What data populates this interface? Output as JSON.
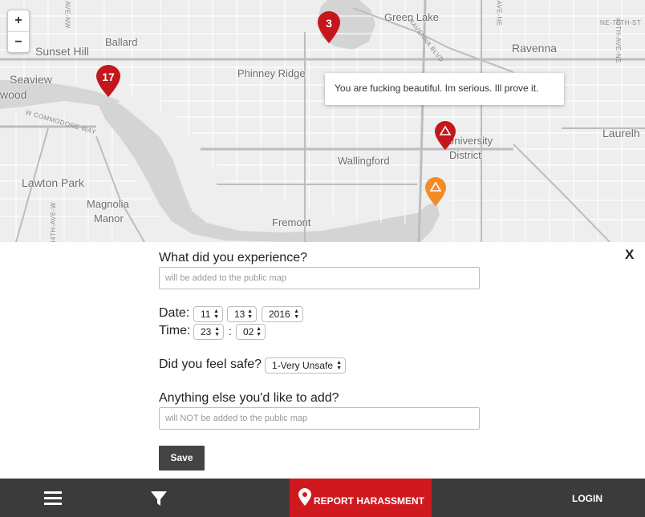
{
  "map": {
    "zoom_in_label": "+",
    "zoom_out_label": "−",
    "places": {
      "sunset_hill": "Sunset Hill",
      "ballard": "Ballard",
      "seaview": "Seaview",
      "wood": "wood",
      "phinney_ridge": "Phinney Ridge",
      "green_lake": "Green Lake",
      "ravenna": "Ravenna",
      "laurelhurst": "Laurelh",
      "university_district_1": "University",
      "university_district_2": "District",
      "wallingford": "Wallingford",
      "lawton_park": "Lawton Park",
      "magnolia_1": "Magnolia",
      "magnolia_2": "Manor",
      "fremont": "Fremont"
    },
    "streets": {
      "commodore_way": "W COMMODORE WAY",
      "ave_nw_top": "AVE-NW",
      "ave_ne": "AVE-NE",
      "ne_70th": "NE-70TH-ST",
      "ave_ne_40th": "40TH-AVE-NE",
      "ave_w_34th": "34TH-AVE-W",
      "ravenna_blvd": "RAVENNA BLVD"
    },
    "markers": [
      {
        "label": "3",
        "color": "#c4161c"
      },
      {
        "label": "17",
        "color": "#c4161c"
      },
      {
        "label": "",
        "icon": "warning-icon",
        "color": "#c4161c"
      },
      {
        "label": "",
        "icon": "warning-icon",
        "color": "#f28c28"
      }
    ],
    "popup_text": "You are fucking beautiful. Im serious. Ill prove it."
  },
  "form": {
    "close_label": "X",
    "experience_question": "What did you experience?",
    "experience_placeholder": "will be added to the public map",
    "date_label": "Date:",
    "date_month": "11",
    "date_day": "13",
    "date_year": "2016",
    "time_label": "Time:",
    "time_hour": "23",
    "time_sep": ":",
    "time_minute": "02",
    "safe_question": "Did you feel safe?",
    "safe_value": "1-Very Unsafe",
    "additional_question": "Anything else you'd like to add?",
    "additional_placeholder": "will NOT be added to the public map",
    "save_label": "Save"
  },
  "footer": {
    "menu_icon": "hamburger-icon",
    "filter_icon": "filter-icon",
    "report_label": "REPORT HARASSMENT",
    "login_label": "LOGIN"
  },
  "colors": {
    "brand_red": "#d0191f",
    "marker_red": "#c4161c",
    "marker_orange": "#f28c28",
    "footer_bg": "#3b3b3b",
    "save_bg": "#444444"
  }
}
